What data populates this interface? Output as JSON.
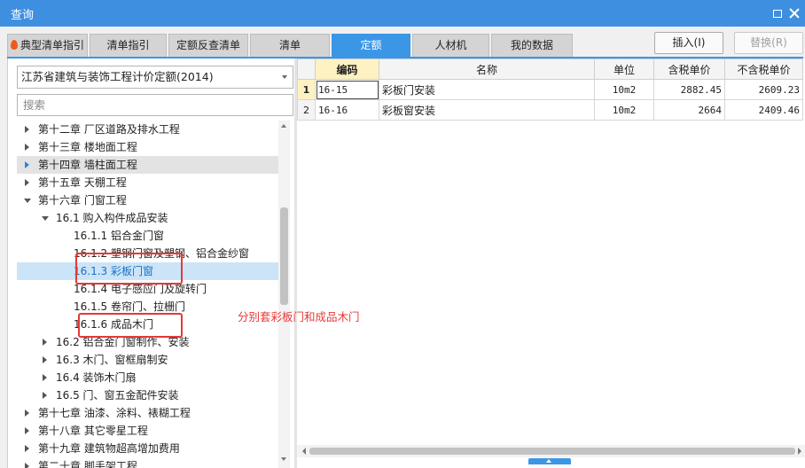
{
  "window": {
    "title": "查询"
  },
  "tabs": [
    {
      "label": "典型清单指引",
      "active": false,
      "icon": "flame-icon"
    },
    {
      "label": "清单指引",
      "active": false
    },
    {
      "label": "定额反查清单",
      "active": false
    },
    {
      "label": "清单",
      "active": false
    },
    {
      "label": "定额",
      "active": true
    },
    {
      "label": "人材机",
      "active": false
    },
    {
      "label": "我的数据",
      "active": false
    }
  ],
  "toolbar": {
    "insert_label": "插入(I)",
    "replace_label": "替换(R)"
  },
  "left": {
    "library_selected": "江苏省建筑与装饰工程计价定额(2014)",
    "search_placeholder": "搜索",
    "tree": [
      {
        "label": "第十二章 厂区道路及排水工程",
        "level": 0,
        "state": "collapsed"
      },
      {
        "label": "第十三章 楼地面工程",
        "level": 0,
        "state": "collapsed"
      },
      {
        "label": "第十四章 墙柱面工程",
        "level": 0,
        "state": "collapsed",
        "hover": true
      },
      {
        "label": "第十五章 天棚工程",
        "level": 0,
        "state": "collapsed"
      },
      {
        "label": "第十六章 门窗工程",
        "level": 0,
        "state": "expanded"
      },
      {
        "label": "16.1 购入构件成品安装",
        "level": 1,
        "state": "expanded"
      },
      {
        "label": "16.1.1 铝合金门窗",
        "level": 2,
        "state": "leaf"
      },
      {
        "label": "16.1.2 塑钢门窗及塑钢、铝合金纱窗",
        "level": 2,
        "state": "leaf"
      },
      {
        "label": "16.1.3 彩板门窗",
        "level": 2,
        "state": "leaf",
        "selected": true
      },
      {
        "label": "16.1.4 电子感应门及旋转门",
        "level": 2,
        "state": "leaf"
      },
      {
        "label": "16.1.5 卷帘门、拉栅门",
        "level": 2,
        "state": "leaf"
      },
      {
        "label": "16.1.6 成品木门",
        "level": 2,
        "state": "leaf"
      },
      {
        "label": "16.2 铝合金门窗制作、安装",
        "level": 1,
        "state": "collapsed"
      },
      {
        "label": "16.3 木门、窗框扇制安",
        "level": 1,
        "state": "collapsed"
      },
      {
        "label": "16.4 装饰木门扇",
        "level": 1,
        "state": "collapsed"
      },
      {
        "label": "16.5 门、窗五金配件安装",
        "level": 1,
        "state": "collapsed"
      },
      {
        "label": "第十七章 油漆、涂料、裱糊工程",
        "level": 0,
        "state": "collapsed"
      },
      {
        "label": "第十八章 其它零星工程",
        "level": 0,
        "state": "collapsed"
      },
      {
        "label": "第十九章 建筑物超高增加费用",
        "level": 0,
        "state": "collapsed"
      },
      {
        "label": "第二十章 脚手架工程",
        "level": 0,
        "state": "collapsed"
      }
    ]
  },
  "table": {
    "columns": [
      "编码",
      "名称",
      "单位",
      "含税单价",
      "不含税单价"
    ],
    "rows": [
      {
        "index": "1",
        "code": "16-15",
        "name": "彩板门安装",
        "unit": "10m2",
        "price_tax": "2882.45",
        "price_notax": "2609.23"
      },
      {
        "index": "2",
        "code": "16-16",
        "name": "彩板窗安装",
        "unit": "10m2",
        "price_tax": "2664",
        "price_notax": "2409.46"
      }
    ]
  },
  "annotation": {
    "text": "分别套彩板门和成品木门",
    "color": "#e53935"
  },
  "colors": {
    "titlebar": "#3f8fe0",
    "accent": "#3b96e6",
    "selected_row": "#cce4f7",
    "annotation": "#e53935"
  }
}
